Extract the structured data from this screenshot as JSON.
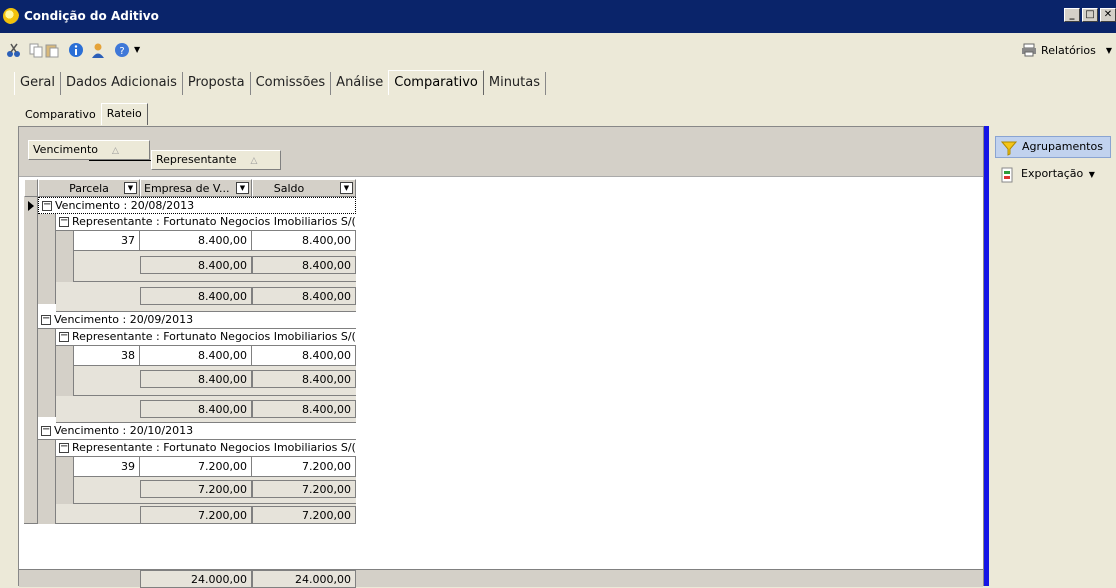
{
  "window": {
    "title": "Condição do Aditivo",
    "min": "_",
    "max": "□",
    "close": "✕"
  },
  "toolbar": {
    "relatorios": "Relatórios",
    "dropdown": "▼"
  },
  "tabs": [
    "Geral",
    "Dados Adicionais",
    "Proposta",
    "Comissões",
    "Análise",
    "Comparativo",
    "Minutas"
  ],
  "active_tab": "Comparativo",
  "subtabs": [
    "Comparativo",
    "Rateio"
  ],
  "active_subtab": "Rateio",
  "grouping": {
    "chip1": "Vencimento",
    "chip2": "Representante",
    "sort_glyph": "△"
  },
  "columns": {
    "parcela": "Parcela",
    "empresa": "Empresa de V...",
    "saldo": "Saldo",
    "filter_glyph": "▼"
  },
  "groups": [
    {
      "vencimento": "Vencimento : 20/08/2013",
      "representante": "Representante : Fortunato Negocios Imobiliarios S/(",
      "parcela": "37",
      "empresa": "8.400,00",
      "saldo": "8.400,00",
      "sub_empresa": "8.400,00",
      "sub_saldo": "8.400,00",
      "tot_empresa": "8.400,00",
      "tot_saldo": "8.400,00"
    },
    {
      "vencimento": "Vencimento : 20/09/2013",
      "representante": "Representante : Fortunato Negocios Imobiliarios S/(",
      "parcela": "38",
      "empresa": "8.400,00",
      "saldo": "8.400,00",
      "sub_empresa": "8.400,00",
      "sub_saldo": "8.400,00",
      "tot_empresa": "8.400,00",
      "tot_saldo": "8.400,00"
    },
    {
      "vencimento": "Vencimento : 20/10/2013",
      "representante": "Representante : Fortunato Negocios Imobiliarios S/(",
      "parcela": "39",
      "empresa": "7.200,00",
      "saldo": "7.200,00",
      "sub_empresa": "7.200,00",
      "sub_saldo": "7.200,00",
      "tot_empresa": "7.200,00",
      "tot_saldo": "7.200,00"
    }
  ],
  "grand_total": {
    "empresa": "24.000,00",
    "saldo": "24.000,00"
  },
  "side": {
    "agrupamentos": "Agrupamentos",
    "exportacao": "Exportação",
    "exportacao_arrow": "▼"
  },
  "colors": {
    "title_bar": "#0a246a",
    "divider": "#1515e6",
    "panel_bg": "#ece9d8"
  }
}
